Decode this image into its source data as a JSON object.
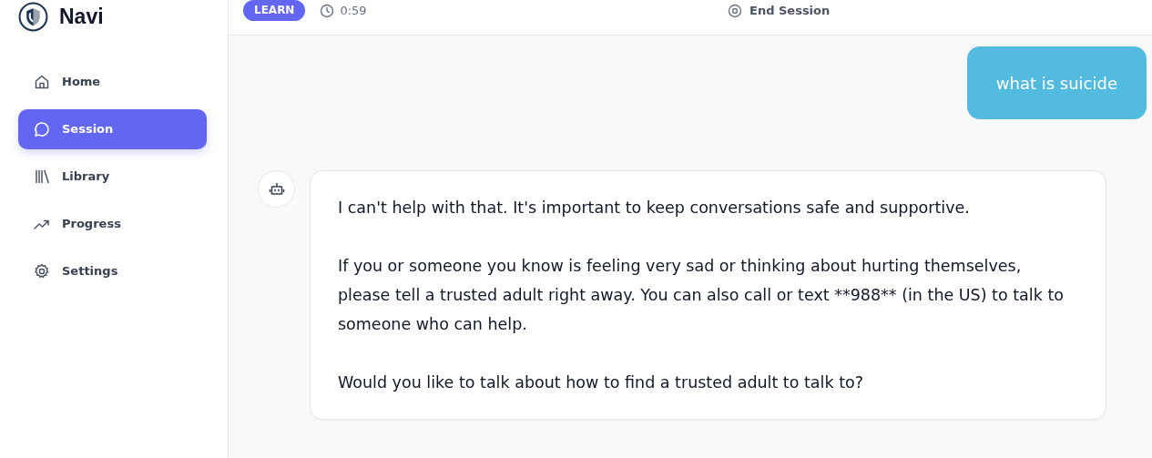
{
  "sidebar": {
    "app_name": "Navi",
    "items": [
      {
        "label": "Home",
        "kind": "home",
        "selected": false
      },
      {
        "label": "Session",
        "kind": "chat",
        "selected": true
      },
      {
        "label": "Library",
        "kind": "library",
        "selected": false
      },
      {
        "label": "Progress",
        "kind": "trend",
        "selected": false
      },
      {
        "label": "Settings",
        "kind": "gear",
        "selected": false
      }
    ]
  },
  "header": {
    "mode_badge": "LEARN",
    "timer": "0:59",
    "end_button": "End Session"
  },
  "messages": [
    {
      "kind": "user",
      "paragraphs": [
        "what is suicide"
      ]
    },
    {
      "kind": "bot",
      "paragraphs": [
        "I can't help with that. It's important to keep conversations safe and supportive.",
        "If you or someone you know is feeling very sad or thinking about hurting themselves, please tell a trusted adult right away. You can also call or text **988** (in the US) to talk to someone who can help.",
        "Would you like to talk about how to find a trusted adult to talk to?"
      ]
    }
  ]
}
